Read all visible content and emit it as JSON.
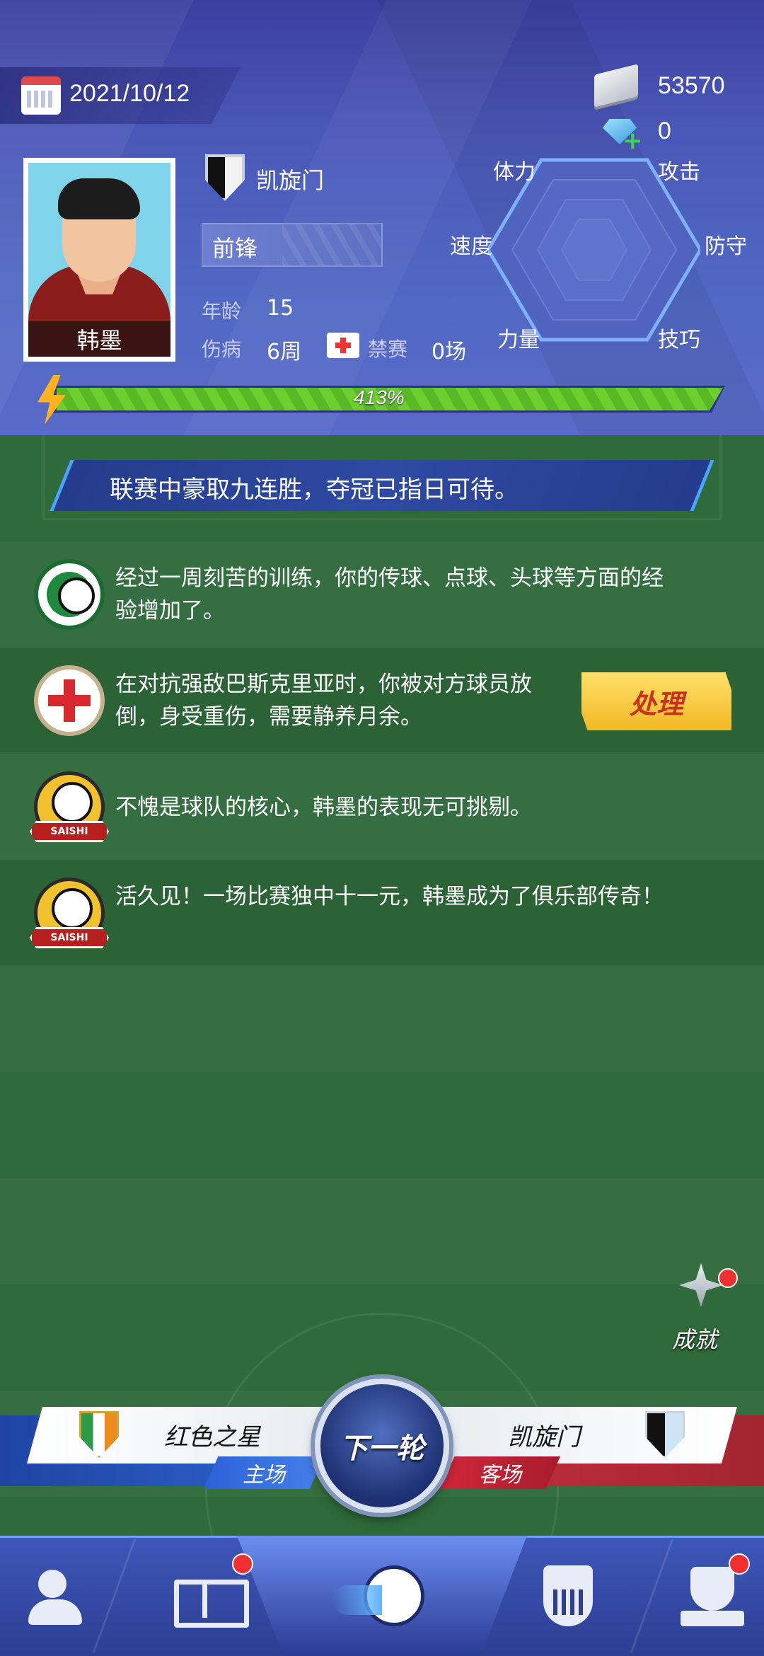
{
  "header": {
    "date": "2021/10/12",
    "money": "53570",
    "gems": "0",
    "player": {
      "name": "韩墨",
      "club": "凯旋门",
      "position": "前锋",
      "age_label": "年龄",
      "age": "15",
      "injury_label": "伤病",
      "injury": "6周",
      "suspension_label": "禁赛",
      "suspension": "0场"
    },
    "stats": {
      "stamina": "体力",
      "attack": "攻击",
      "speed": "速度",
      "defense": "防守",
      "strength": "力量",
      "technique": "技巧"
    },
    "energy": {
      "text": "413%",
      "fill": 1.0
    }
  },
  "headline": "联赛中豪取九连胜，夺冠已指日可待。",
  "events": [
    {
      "type": "training-icon",
      "text": "经过一周刻苦的训练，你的传球、点球、头球等方面的经验增加了。"
    },
    {
      "type": "medical-icon",
      "text": "在对抗强敌巴斯克里亚时，你被对方球员放倒，身受重伤，需要静养月余。",
      "action": "处理"
    },
    {
      "type": "saishi-icon",
      "text": "不愧是球队的核心，韩墨的表现无可挑剔。"
    },
    {
      "type": "saishi-icon",
      "text": "活久见！一场比赛独中十一元，韩墨成为了俱乐部传奇！"
    }
  ],
  "saishi_label": "SAISHI",
  "achievement": "成就",
  "match": {
    "home_team": "红色之星",
    "home_tag": "主场",
    "away_team": "凯旋门",
    "away_tag": "客场",
    "next_label": "下一轮"
  },
  "nav": [
    {
      "icon": "players-icon"
    },
    {
      "icon": "formation-icon",
      "badge": true
    },
    {
      "icon": "match-icon",
      "active": true
    },
    {
      "icon": "club-icon"
    },
    {
      "icon": "trophy-icon",
      "badge": true
    }
  ],
  "colors": {
    "header_bg": "#4a58b8",
    "pitch": "#2e6a3a",
    "energy": "#6ccf2e",
    "handle_button": "#f2b824",
    "nav": "#2d3e92"
  }
}
